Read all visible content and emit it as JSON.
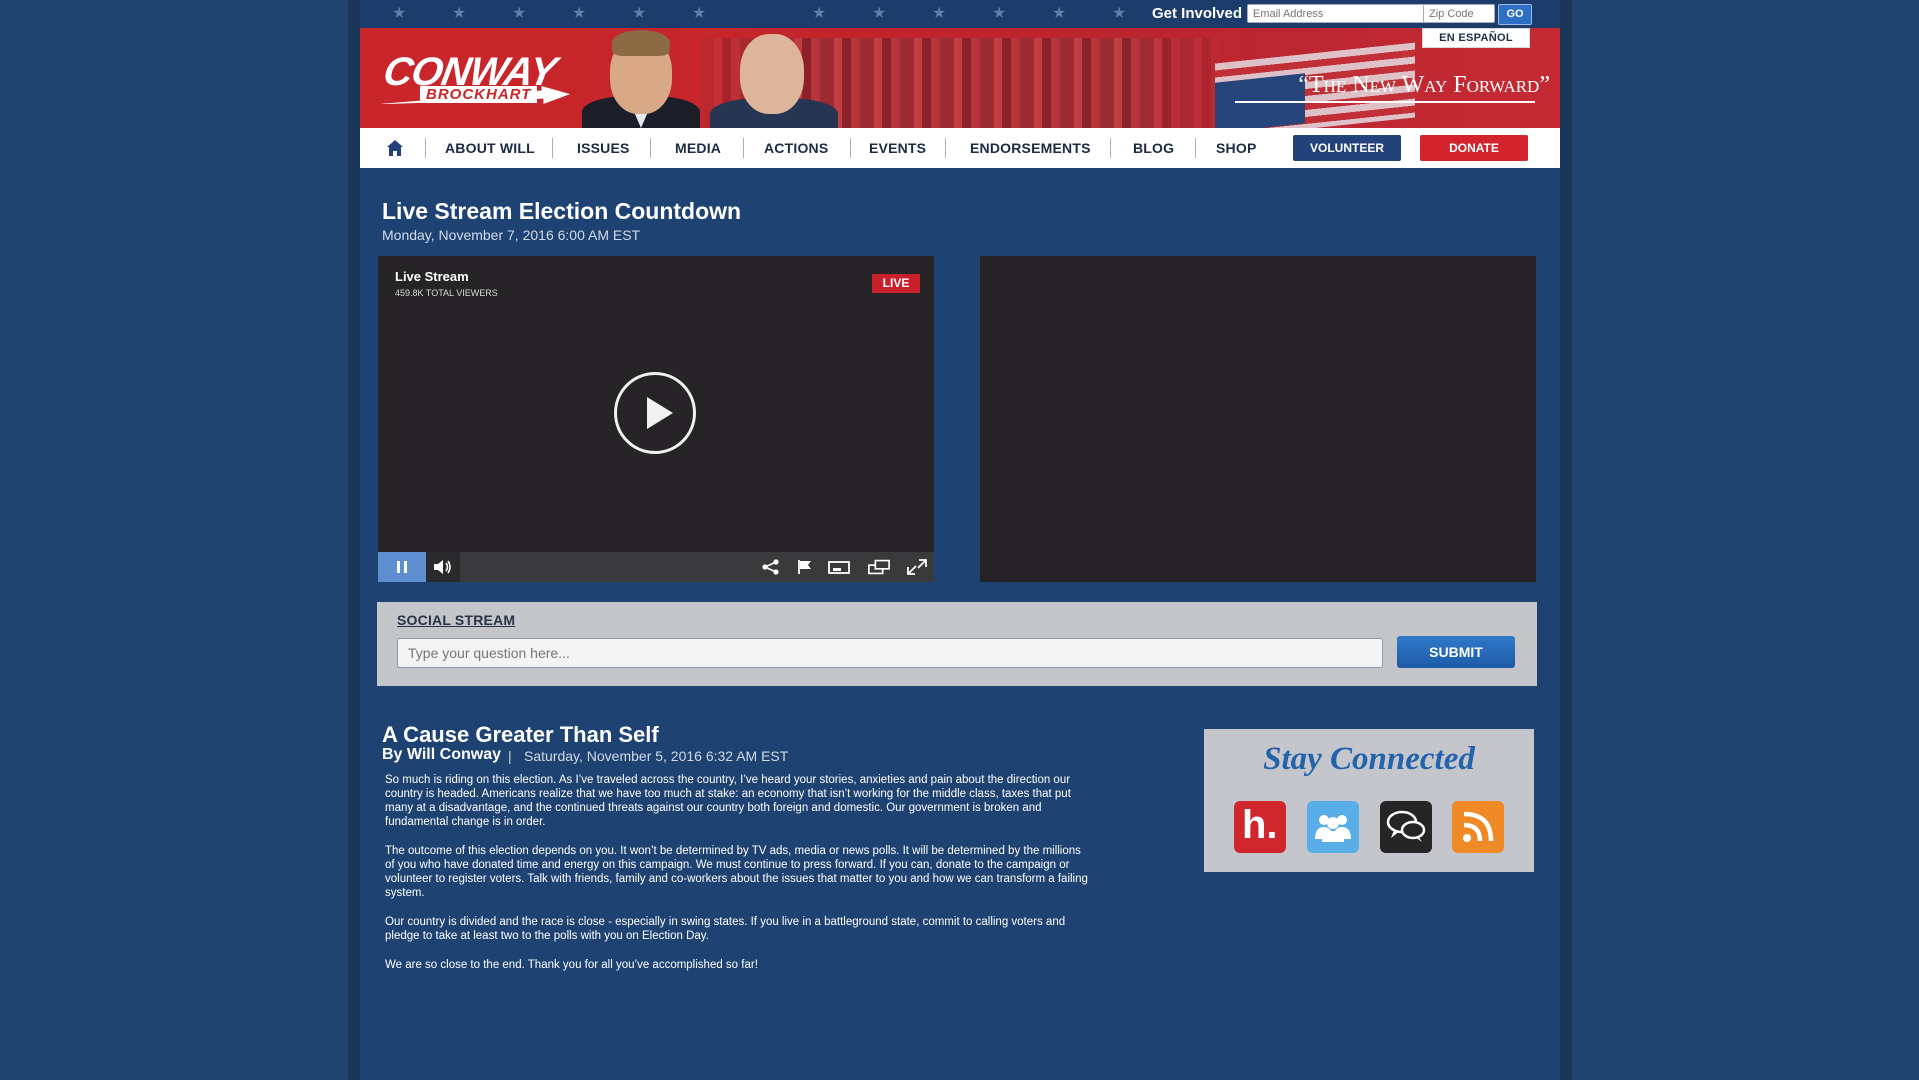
{
  "header": {
    "get_involved_label": "Get Involved",
    "email_placeholder": "Email Address",
    "zip_placeholder": "Zip Code",
    "go_label": "GO",
    "logo_main": "CONWAY",
    "logo_sub": "BROCKHART",
    "tagline": "“The New Way Forward”",
    "espanol_label": "EN ESPAÑOL"
  },
  "nav": {
    "items": [
      "ABOUT WILL",
      "ISSUES",
      "MEDIA",
      "ACTIONS",
      "EVENTS",
      "ENDORSEMENTS",
      "BLOG",
      "SHOP"
    ],
    "volunteer_label": "VOLUNTEER",
    "donate_label": "DONATE"
  },
  "event": {
    "title": "Live Stream Election Countdown",
    "date": "Monday, November 7, 2016  6:00 AM EST"
  },
  "video": {
    "title": "Live Stream",
    "viewers": "459.8K TOTAL VIEWERS",
    "live_label": "LIVE"
  },
  "social": {
    "title": "SOCIAL STREAM",
    "input_placeholder": "Type your question here...",
    "submit_label": "SUBMIT"
  },
  "post": {
    "title": "A Cause Greater Than Self",
    "author": "By Will Conway",
    "separator": "|",
    "date": "Saturday, November 5, 2016   6:32 AM EST",
    "paragraphs": [
      "So much is riding on this election.  As I’ve traveled across the country, I’ve heard your stories, anxieties and pain about the direction our country is headed.  Americans realize that we have too much at stake:  an economy that isn’t working for the middle class, taxes that put many at a disadvantage, and the continued threats against our country both foreign and domestic.  Our government is broken and fundamental change is in order.",
      "The outcome of this election depends on you.  It won’t be determined by TV ads, media or news polls.  It will be determined by the millions of you who have donated time and energy on this campaign.  We must continue to press forward.  If you can, donate to the campaign or volunteer to register voters.  Talk with friends, family and co-workers about the issues that matter to you and how we can transform a failing system.",
      "Our country is divided and the race is close - especially in swing states.  If you live in a battleground state, commit to calling voters and pledge to take at least two to the polls with you on Election Day.",
      "We are so close to the end.  Thank you for all you’ve accomplished so far!"
    ]
  },
  "stay_connected": {
    "title": "Stay Connected",
    "h_letter": "h."
  }
}
